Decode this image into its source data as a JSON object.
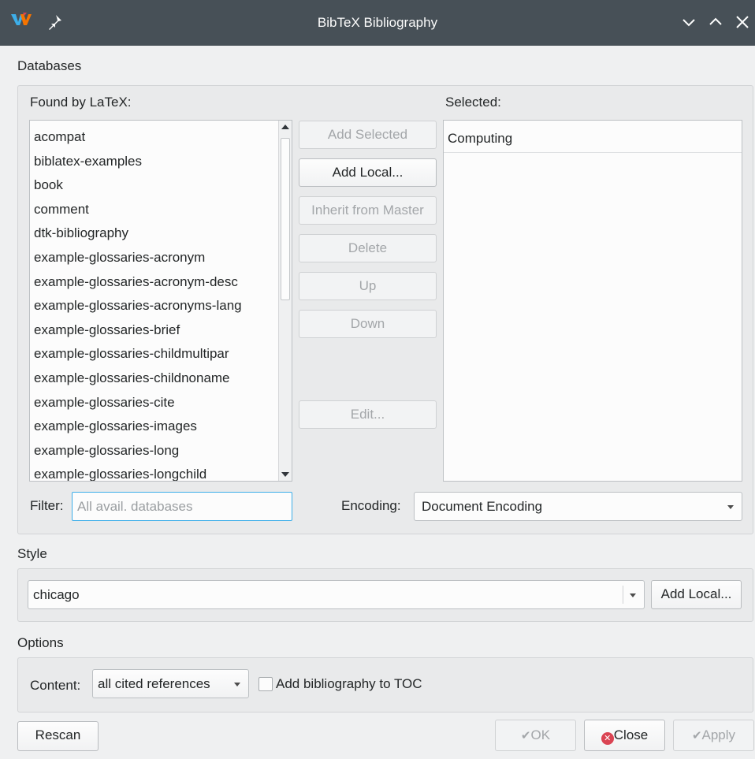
{
  "window": {
    "title": "BibTeX Bibliography"
  },
  "databases": {
    "section_label": "Databases",
    "found_label": "Found by LaTeX:",
    "selected_label": "Selected:",
    "found_items": [
      "acompat",
      "biblatex-examples",
      "book",
      "comment",
      "dtk-bibliography",
      "example-glossaries-acronym",
      "example-glossaries-acronym-desc",
      "example-glossaries-acronyms-lang",
      "example-glossaries-brief",
      "example-glossaries-childmultipar",
      "example-glossaries-childnoname",
      "example-glossaries-cite",
      "example-glossaries-images",
      "example-glossaries-long",
      "example-glossaries-longchild"
    ],
    "selected_items": [
      "Computing"
    ],
    "buttons": {
      "add_selected": "Add Selected",
      "add_local": "Add Local...",
      "inherit": "Inherit from Master",
      "delete": "Delete",
      "up": "Up",
      "down": "Down",
      "edit": "Edit..."
    },
    "filter_label": "Filter:",
    "filter_placeholder": "All avail. databases",
    "encoding_label": "Encoding:",
    "encoding_value": "Document Encoding"
  },
  "style": {
    "section_label": "Style",
    "value": "chicago",
    "add_local": "Add Local..."
  },
  "options": {
    "section_label": "Options",
    "content_label": "Content:",
    "content_value": "all cited references",
    "toc_checkbox_label": "Add bibliography to TOC",
    "toc_checked": false
  },
  "footer": {
    "rescan": "Rescan",
    "ok": "OK",
    "close": "Close",
    "apply": "Apply"
  },
  "colors": {
    "titlebar": "#475057",
    "window_bg": "#eff0f1",
    "focus": "#3daee9",
    "close_icon": "#da4453"
  }
}
